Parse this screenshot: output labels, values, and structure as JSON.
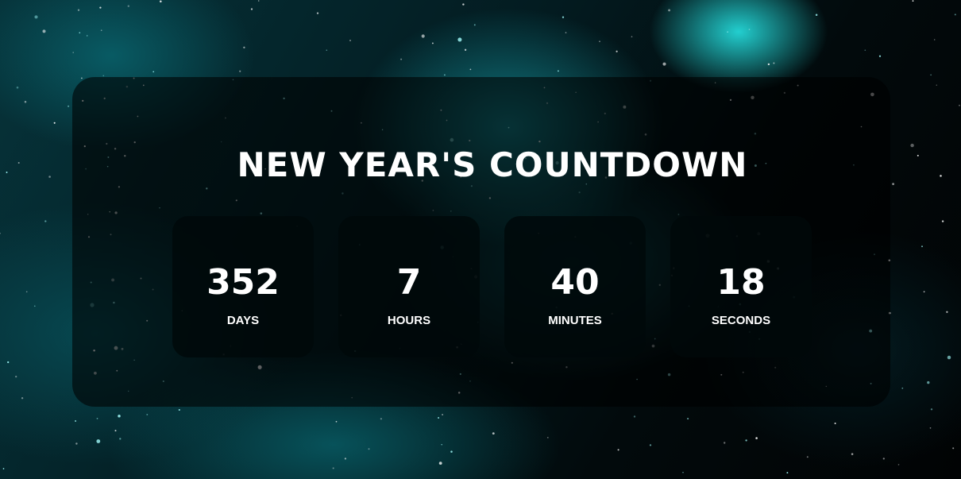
{
  "title": "NEW YEAR'S COUNTDOWN",
  "countdown": [
    {
      "value": "352",
      "label": "DAYS"
    },
    {
      "value": "7",
      "label": "HOURS"
    },
    {
      "value": "40",
      "label": "MINUTES"
    },
    {
      "value": "18",
      "label": "SECONDS"
    }
  ],
  "colors": {
    "text": "#ffffff",
    "panel": "#000000",
    "accent": "#1ee6e6"
  }
}
